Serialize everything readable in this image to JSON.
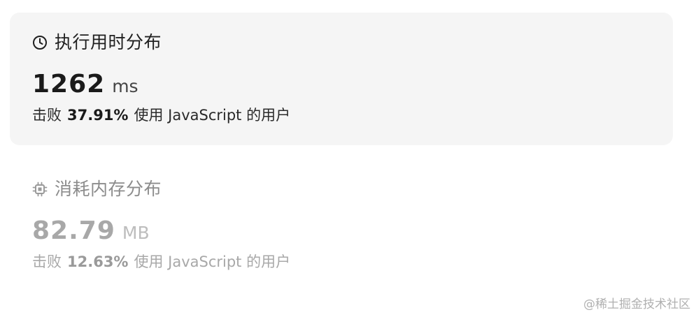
{
  "runtime": {
    "title": "执行用时分布",
    "icon": "clock-icon",
    "value": "1262",
    "unit": "ms",
    "beat_prefix": "击败",
    "percent": "37.91%",
    "beat_suffix": "使用 JavaScript 的用户",
    "state": "selected"
  },
  "memory": {
    "title": "消耗内存分布",
    "icon": "memory-chip-icon",
    "value": "82.79",
    "unit": "MB",
    "beat_prefix": "击败",
    "percent": "12.63%",
    "beat_suffix": "使用 JavaScript 的用户",
    "state": "unselected"
  },
  "watermark": "@稀土掘金技术社区",
  "colors": {
    "selected_bg": "#f5f5f5",
    "text_dark": "#1a1a1a",
    "text_muted": "#a8a8a8"
  }
}
